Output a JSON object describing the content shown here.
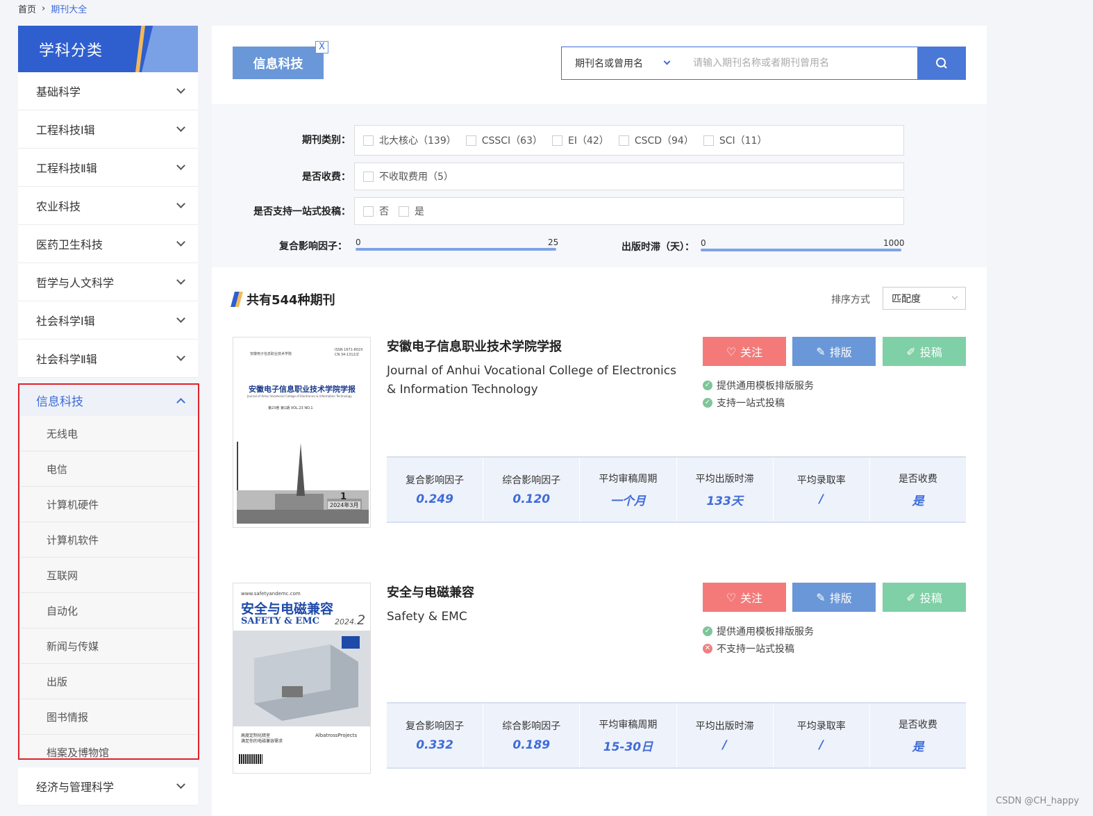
{
  "breadcrumb": {
    "home": "首页",
    "sep": "›",
    "current": "期刊大全"
  },
  "sidebar": {
    "title": "学科分类",
    "categories": [
      "基础科学",
      "工程科技Ⅰ辑",
      "工程科技Ⅱ辑",
      "农业科技",
      "医药卫生科技",
      "哲学与人文科学",
      "社会科学Ⅰ辑",
      "社会科学Ⅱ辑"
    ],
    "open": {
      "label": "信息科技",
      "items": [
        "无线电",
        "电信",
        "计算机硬件",
        "计算机软件",
        "互联网",
        "自动化",
        "新闻与传媒",
        "出版",
        "图书情报",
        "档案及博物馆"
      ]
    },
    "after": "经济与管理科学"
  },
  "topbar": {
    "tag": "信息科技",
    "tag_close": "X",
    "search_type": "期刊名或曾用名",
    "search_placeholder": "请输入期刊名称或者期刊曾用名"
  },
  "filter": {
    "type_label": "期刊类别：",
    "types": [
      "北大核心（139）",
      "CSSCI（63）",
      "EI（42）",
      "CSCD（94）",
      "SCI（11）"
    ],
    "fee_label": "是否收费：",
    "fee_opts": [
      "不收取费用（5）"
    ],
    "onestop_label": "是否支持一站式投稿：",
    "onestop_opts": [
      "否",
      "是"
    ],
    "impact_label": "复合影响因子：",
    "impact_min": "0",
    "impact_max": "25",
    "delay_label": "出版时滞（天）：",
    "delay_min": "0",
    "delay_max": "1000"
  },
  "results": {
    "count_text": "共有544种期刊",
    "sort_label": "排序方式",
    "sort_value": "匹配度"
  },
  "buttons": {
    "follow": "关注",
    "layout": "排版",
    "submit": "投稿"
  },
  "stat_keys": [
    "复合影响因子",
    "综合影响因子",
    "平均审稿周期",
    "平均出版时滞",
    "平均录取率",
    "是否收费"
  ],
  "journals": [
    {
      "title": "安徽电子信息职业技术学院学报",
      "en": "Journal of Anhui Vocational College of Electronics & Information Technology",
      "svc1": "提供通用模板排版服务",
      "svc2": "支持一站式投稿",
      "svc2_ok": true,
      "cover": {
        "top": "安徽电子信息职业技术学院",
        "issn": "ISSN 1671-802X",
        "cn": "CN 34-1312/Z",
        "name": "安徽电子信息职业技术学院学报",
        "sub": "Journal of Anhui Vocational College of Electronics & Information Technology",
        "issue": "第23卷 第1期 VOL.23 NO.1",
        "num": "1",
        "date": "2024年3月"
      },
      "stats": [
        "0.249",
        "0.120",
        "一个月",
        "133天",
        "/",
        "是"
      ]
    },
    {
      "title": "安全与电磁兼容",
      "en": "Safety & EMC",
      "svc1": "提供通用模板排版服务",
      "svc2": "不支持一站式投稿",
      "svc2_ok": false,
      "cover": {
        "url": "www.safetyandemc.com",
        "name": "安全与电磁兼容",
        "en": "SAFETY & EMC",
        "year": "2024.",
        "num": "2",
        "foot1": "高度定制化暗室",
        "foot2": "满足你的电磁兼容需求",
        "brand": "AlbatrossProjects"
      },
      "stats": [
        "0.332",
        "0.189",
        "15-30日",
        "/",
        "/",
        "是"
      ]
    }
  ],
  "watermark": "CSDN @CH_happy",
  "colors": {
    "primary": "#3f6cd8",
    "follow": "#f47a7a",
    "layout": "#6a97d7",
    "submit": "#7fd0a6",
    "highlight": "#e0212b"
  }
}
